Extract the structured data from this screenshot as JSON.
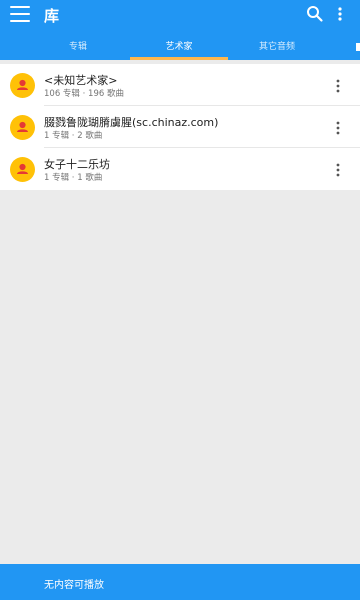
{
  "header": {
    "title": "库",
    "menu_icon": "menu-icon",
    "search_icon": "search-icon",
    "more_icon": "more-vert-icon",
    "bg": "#2196f3"
  },
  "tabs": {
    "items": [
      {
        "label": "专辑"
      },
      {
        "label": "艺术家"
      },
      {
        "label": "其它音频"
      }
    ],
    "active_index": 1,
    "indicator_color": "#ffb74d"
  },
  "artists": [
    {
      "name": "<未知艺术家>",
      "details": "106 专辑 · 196 歌曲"
    },
    {
      "name": "腏戮鲁陇瑚膌虜腥(sc.chinaz.com)",
      "details": "1 专辑 · 2 歌曲"
    },
    {
      "name": "女子十二乐坊",
      "details": "1 专辑 · 1 歌曲"
    }
  ],
  "player": {
    "status": "无内容可播放"
  },
  "colors": {
    "avatar": "#ffc107",
    "avatar_icon": "#e53935"
  }
}
